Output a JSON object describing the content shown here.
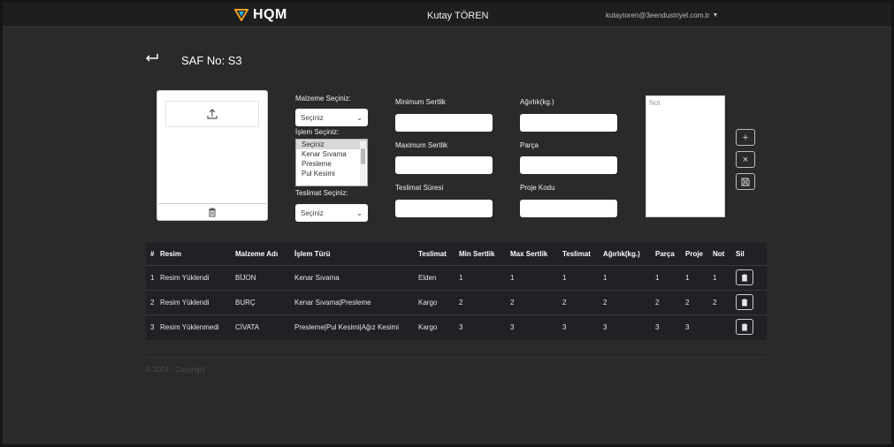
{
  "navbar": {
    "brand_text": "HQM",
    "user_name": "Kutay TÖREN",
    "user_email": "kutaytoren@3eendustriyel.com.tr"
  },
  "page": {
    "title": "SAF No: S3"
  },
  "form": {
    "malzeme_label": "Malzeme Seçiniz:",
    "malzeme_value": "Seçiniz",
    "islem_label": "İşlem Seçiniz:",
    "islem_options": [
      "Seçiniz",
      "Kenar Sıvama",
      "Presleme",
      "Pul Kesimi"
    ],
    "teslimat_label": "Teslimat Seçiniz:",
    "teslimat_value": "Seçiniz",
    "min_sertlik_label": "Minimum Sertlik",
    "max_sertlik_label": "Maximum Sertlik",
    "teslimat_suresi_label": "Teslimat Süresi",
    "agirlik_label": "Ağırlık(kg.)",
    "parca_label": "Parça",
    "proje_kodu_label": "Proje Kodu",
    "note_placeholder": "Not"
  },
  "table": {
    "headers": [
      "#",
      "Resim",
      "Malzeme Adı",
      "İşlem Türü",
      "Teslimat",
      "Min Sertlik",
      "Max Sertlik",
      "Teslimat",
      "Ağırlık(kg.)",
      "Parça",
      "Proje",
      "Not",
      "Sil"
    ],
    "rows": [
      [
        "1",
        "Resim Yüklendi",
        "BİJON",
        "Kenar Sıvama",
        "Elden",
        "1",
        "1",
        "1",
        "1",
        "1",
        "1",
        "1"
      ],
      [
        "2",
        "Resim Yüklendi",
        "BURÇ",
        "Kenar Sıvama|Presleme",
        "Kargo",
        "2",
        "2",
        "2",
        "2",
        "2",
        "2",
        "2"
      ],
      [
        "3",
        "Resim Yüklenmedi",
        "CİVATA",
        "Presleme|Pul Kesimi|Ağız Kesimi",
        "Kargo",
        "3",
        "3",
        "3",
        "3",
        "3",
        "3",
        ""
      ]
    ]
  },
  "footer": {
    "text": "© 2024 - Copyright"
  },
  "colors": {
    "background": "#2a2a2a",
    "navbar": "#1d1e20",
    "table": "#1f2124",
    "logo_accent": "#f0a020",
    "logo_accent2": "#2bb0e6"
  }
}
